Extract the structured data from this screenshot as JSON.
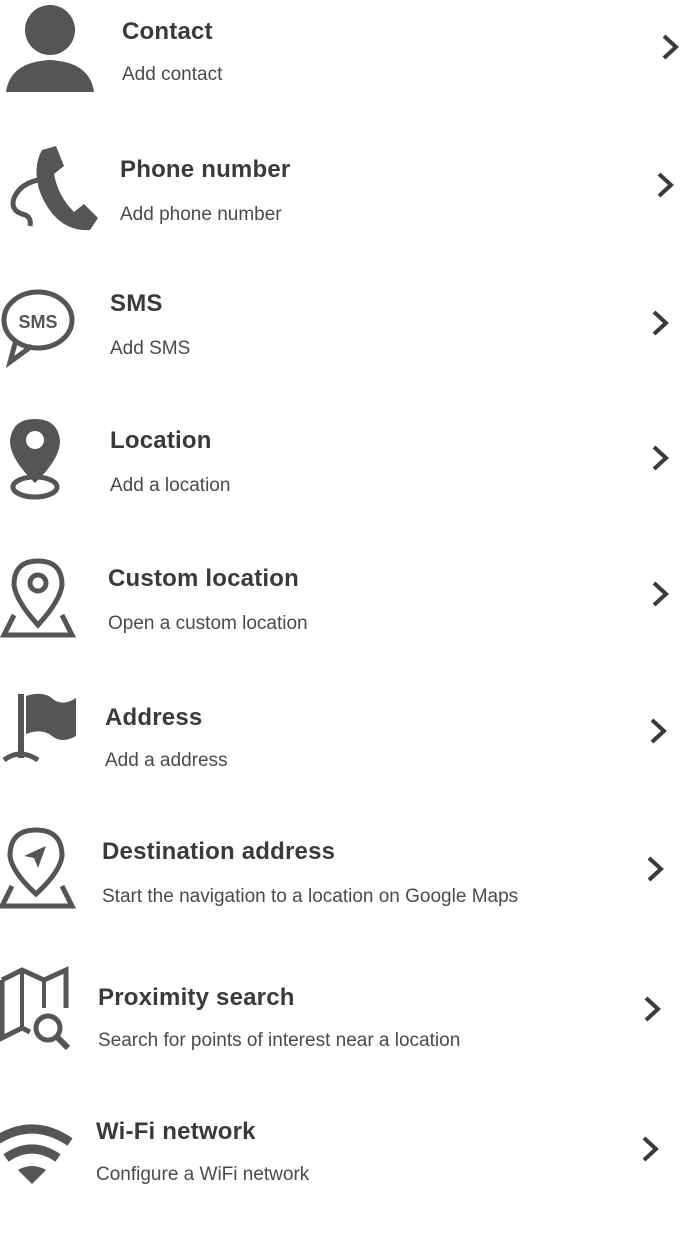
{
  "items": [
    {
      "title": "Contact",
      "subtitle": "Add contact",
      "icon": "person-icon"
    },
    {
      "title": "Phone number",
      "subtitle": "Add phone number",
      "icon": "phone-icon"
    },
    {
      "title": "SMS",
      "subtitle": "Add SMS",
      "icon": "sms-bubble-icon"
    },
    {
      "title": "Location",
      "subtitle": "Add a location",
      "icon": "location-pin-icon"
    },
    {
      "title": "Custom location",
      "subtitle": "Open a custom location",
      "icon": "custom-location-pin-icon"
    },
    {
      "title": "Address",
      "subtitle": "Add a address",
      "icon": "flag-icon"
    },
    {
      "title": "Destination address",
      "subtitle": "Start the navigation to a location on Google Maps",
      "icon": "navigation-pin-icon"
    },
    {
      "title": "Proximity search",
      "subtitle": "Search for points of interest near a location",
      "icon": "map-search-icon"
    },
    {
      "title": "Wi-Fi network",
      "subtitle": "Configure a WiFi network",
      "icon": "wifi-icon"
    }
  ],
  "colors": {
    "icon": "#4a4a4a",
    "title": "#3a3a3a",
    "subtitle": "#4a4a4a",
    "chevron": "#3a3a3a"
  }
}
